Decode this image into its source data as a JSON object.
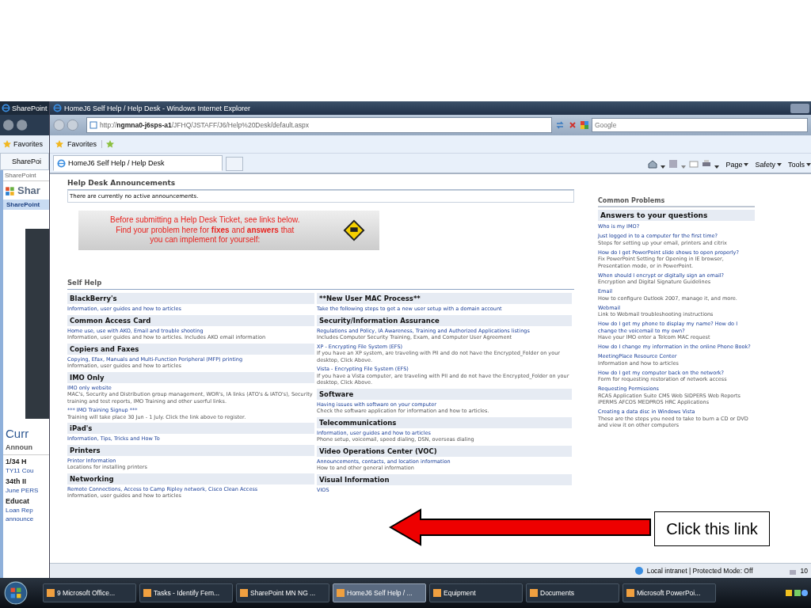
{
  "background_window": {
    "title": "SharePoint",
    "favorites": "Favorites",
    "tab": "SharePoi",
    "site_label": "SharePoint",
    "site_title": "Shar",
    "nav_tab": "SharePoint",
    "heading": "Curr",
    "subheading": "Announ",
    "items": [
      {
        "kind": "heading",
        "text": "1/34 H"
      },
      {
        "kind": "link",
        "text": "TY11 Cou"
      },
      {
        "kind": "heading",
        "text": "34th II"
      },
      {
        "kind": "link",
        "text": "June PERS"
      },
      {
        "kind": "heading",
        "text": "Educat"
      },
      {
        "kind": "link",
        "text": "Loan Rep"
      },
      {
        "kind": "link",
        "text": "announce"
      }
    ]
  },
  "browser": {
    "title": "HomeJ6 Self Help / Help Desk - Windows Internet Explorer",
    "address": "http://**ngmna0-j6sps-a1**/JFHQ/JSTAFF/J6/Help%20Desk/default.aspx",
    "search": {
      "placeholder": "Google"
    },
    "favorites": "Favorites",
    "tabs": [
      {
        "label": "HomeJ6 Self Help / Help Desk",
        "selected": true
      }
    ],
    "commands": [
      "Page",
      "Safety",
      "Tools"
    ],
    "status": "Local intranet | Protected Mode: Off",
    "zoom": "10"
  },
  "announcements": {
    "title": "Help Desk Announcements",
    "text": "There are currently no active announcements."
  },
  "banner": {
    "text": "Before submitting a Help Desk Ticket, see links below.\nFind your problem here for **fixes** and **answers** that\nyou can implement for yourself:"
  },
  "self_help": {
    "title": "Self Help",
    "columns": [
      [
        {
          "title": "BlackBerry's",
          "entries": [
            {
              "link": "Information, user guides and how to articles"
            }
          ]
        },
        {
          "title": "Common Access Card",
          "entries": [
            {
              "link": "Home use, use with AKO, Email and trouble shooting",
              "desc": "Information, user guides and how to articles. Includes AKO email information"
            }
          ]
        },
        {
          "title": "Copiers and Faxes",
          "entries": [
            {
              "link": "Copying, Efax, Manuals and Multi-Function Peripheral (MFP) printing",
              "desc": "Information, user guides and how to articles"
            }
          ]
        },
        {
          "title": "IMO Only",
          "entries": [
            {
              "link": "IMO only website",
              "desc": "MAC's, Security and Distribution group management, WOR's, IA links (ATO's & IATO's), Security training and test reports, IMO Training and other userful links."
            },
            {
              "link": "*** IMO Training Signup ***",
              "desc": "Training will take place 30 Jun - 1 July. Click the link above to register."
            }
          ]
        },
        {
          "title": "iPad's",
          "entries": [
            {
              "link": "Information, Tips, Tricks and How To"
            }
          ]
        },
        {
          "title": "Printers",
          "entries": [
            {
              "link": "Printer Information",
              "desc": "Locations for installing printers"
            }
          ]
        },
        {
          "title": "Networking",
          "entries": [
            {
              "link": "Remote Connections, Access to Camp Ripley network, Cisco Clean Access",
              "desc": "Information, user guides and how to articles"
            }
          ]
        }
      ],
      [
        {
          "title": "**New User MAC Process**",
          "entries": [
            {
              "link": "Take the following steps to get a new user setup with a domain account"
            }
          ]
        },
        {
          "title": "Security/Information Assurance",
          "entries": [
            {
              "link": "Regulations and Policy, IA Awareness, Training and Authorized Applications listings",
              "desc": "Includes Computer Security Training, Exam, and Computer User Agreement"
            },
            {
              "link": "XP - Encrypting File System (EFS)",
              "desc": "If you have an XP system, are traveling with PII and do not have the Encrypted_Folder on your desktop, Click Above."
            },
            {
              "link": "Vista - Encrypting File System (EFS)",
              "desc": "If you have a Vista computer, are traveling with PII and do not have the Encrypted_Folder on your desktop, Click Above."
            }
          ]
        },
        {
          "title": "Software",
          "entries": [
            {
              "link": "Having issues with software on your computer",
              "desc": "Check the software application for information and how to articles."
            }
          ]
        },
        {
          "title": "Telecommunications",
          "entries": [
            {
              "link": "Information, user guides and how to articles",
              "desc": "Phone setup, voicemail, speed dialing, DSN, overseas dialing"
            }
          ]
        },
        {
          "title": "Video Operations Center (VOC)",
          "entries": [
            {
              "link": "Announcements, contacts, and location information",
              "desc": "How to and other general information"
            }
          ]
        },
        {
          "title": "Visual Information",
          "entries": [
            {
              "link": "VIOS"
            }
          ]
        }
      ]
    ]
  },
  "common_problems": {
    "title": "Common Problems",
    "header": "Answers to your questions",
    "entries": [
      {
        "link": "Who is my IMO?"
      },
      {
        "link": "Just logged in to a computer for the first time?",
        "desc": "Steps for setting up your email, printers and citrix"
      },
      {
        "link": "How do I get PowerPoint slide shows to open properly?",
        "desc": "Fix PowerPoint Setting for Opening in IE browser, Presentation mode, or in PowerPoint."
      },
      {
        "link": "When should I encrypt or digitally sign an email?",
        "desc": "Encryption and Digital Signature Guidelines"
      },
      {
        "link": "Email",
        "desc": "How to configure Outlook 2007, manage it, and more."
      },
      {
        "link": "Webmail",
        "desc": "Link to Webmail troubleshooting instructions"
      },
      {
        "link": "How do I get my phone to display my name? How do I change the voicemail to my own?",
        "desc": "Have your IMO enter a Telcom MAC request"
      },
      {
        "link": "How do I change my information in the online Phone Book?"
      },
      {
        "link": "MeetingPlace Resource Center",
        "desc": "Information and how to articles"
      },
      {
        "link": "How do I get my computer back on the network?",
        "desc": "Form for requesting restoration of network access"
      },
      {
        "link": "Requesting Permissions",
        "desc": "RCAS Application Suite CMS Web SIDPERS Web Reports iPERMS AFCOS MEDPROS HRC Applications"
      },
      {
        "link": "Creating a data disc in Windows Vista",
        "desc": "These are the steps you need to take to burn a CD or DVD and view it on other computers"
      }
    ]
  },
  "taskbar": [
    {
      "label": "9 Microsoft Office...",
      "selected": false
    },
    {
      "label": "Tasks - Identify Fem...",
      "selected": false
    },
    {
      "label": "SharePoint MN NG ...",
      "selected": false
    },
    {
      "label": "HomeJ6 Self Help / ...",
      "selected": true
    },
    {
      "label": "Equipment",
      "selected": false
    },
    {
      "label": "Documents",
      "selected": false
    },
    {
      "label": "Microsoft PowerPoi...",
      "selected": false
    }
  ],
  "callout": {
    "text": "Click this link"
  }
}
